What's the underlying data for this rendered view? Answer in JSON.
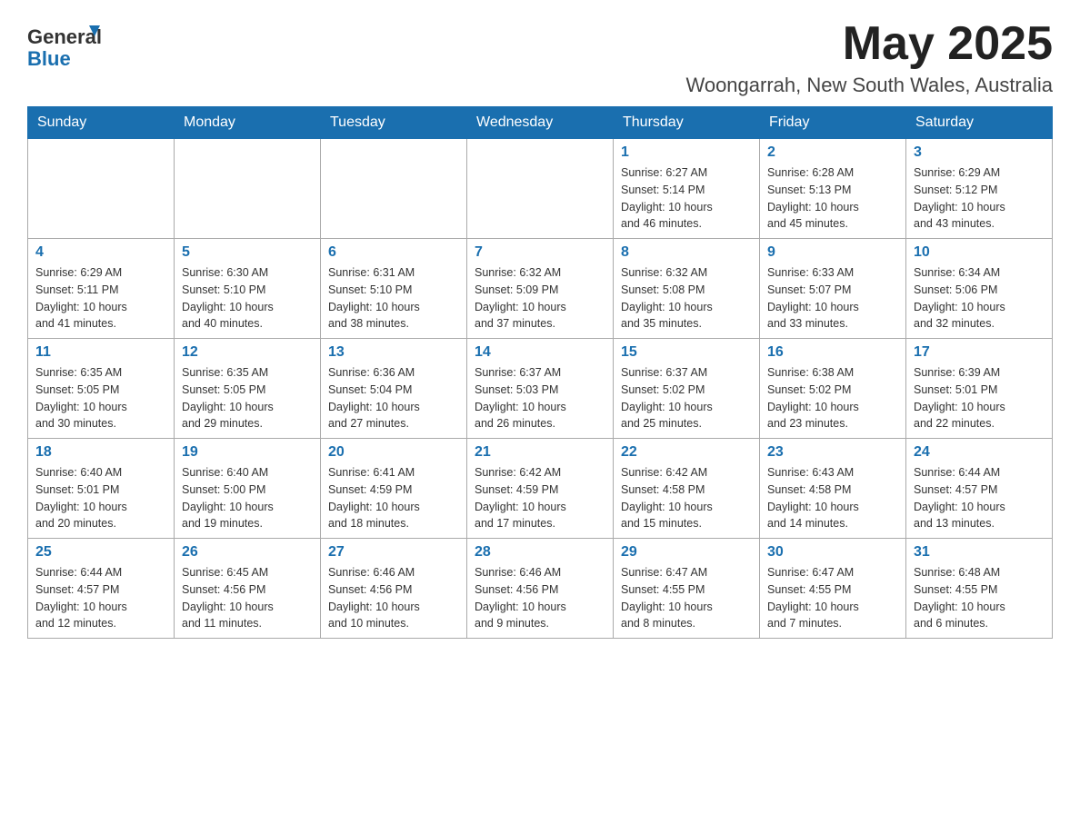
{
  "header": {
    "logo_general": "General",
    "logo_blue": "Blue",
    "month_title": "May 2025",
    "location": "Woongarrah, New South Wales, Australia"
  },
  "weekdays": [
    "Sunday",
    "Monday",
    "Tuesday",
    "Wednesday",
    "Thursday",
    "Friday",
    "Saturday"
  ],
  "weeks": [
    [
      {
        "day": "",
        "info": ""
      },
      {
        "day": "",
        "info": ""
      },
      {
        "day": "",
        "info": ""
      },
      {
        "day": "",
        "info": ""
      },
      {
        "day": "1",
        "info": "Sunrise: 6:27 AM\nSunset: 5:14 PM\nDaylight: 10 hours\nand 46 minutes."
      },
      {
        "day": "2",
        "info": "Sunrise: 6:28 AM\nSunset: 5:13 PM\nDaylight: 10 hours\nand 45 minutes."
      },
      {
        "day": "3",
        "info": "Sunrise: 6:29 AM\nSunset: 5:12 PM\nDaylight: 10 hours\nand 43 minutes."
      }
    ],
    [
      {
        "day": "4",
        "info": "Sunrise: 6:29 AM\nSunset: 5:11 PM\nDaylight: 10 hours\nand 41 minutes."
      },
      {
        "day": "5",
        "info": "Sunrise: 6:30 AM\nSunset: 5:10 PM\nDaylight: 10 hours\nand 40 minutes."
      },
      {
        "day": "6",
        "info": "Sunrise: 6:31 AM\nSunset: 5:10 PM\nDaylight: 10 hours\nand 38 minutes."
      },
      {
        "day": "7",
        "info": "Sunrise: 6:32 AM\nSunset: 5:09 PM\nDaylight: 10 hours\nand 37 minutes."
      },
      {
        "day": "8",
        "info": "Sunrise: 6:32 AM\nSunset: 5:08 PM\nDaylight: 10 hours\nand 35 minutes."
      },
      {
        "day": "9",
        "info": "Sunrise: 6:33 AM\nSunset: 5:07 PM\nDaylight: 10 hours\nand 33 minutes."
      },
      {
        "day": "10",
        "info": "Sunrise: 6:34 AM\nSunset: 5:06 PM\nDaylight: 10 hours\nand 32 minutes."
      }
    ],
    [
      {
        "day": "11",
        "info": "Sunrise: 6:35 AM\nSunset: 5:05 PM\nDaylight: 10 hours\nand 30 minutes."
      },
      {
        "day": "12",
        "info": "Sunrise: 6:35 AM\nSunset: 5:05 PM\nDaylight: 10 hours\nand 29 minutes."
      },
      {
        "day": "13",
        "info": "Sunrise: 6:36 AM\nSunset: 5:04 PM\nDaylight: 10 hours\nand 27 minutes."
      },
      {
        "day": "14",
        "info": "Sunrise: 6:37 AM\nSunset: 5:03 PM\nDaylight: 10 hours\nand 26 minutes."
      },
      {
        "day": "15",
        "info": "Sunrise: 6:37 AM\nSunset: 5:02 PM\nDaylight: 10 hours\nand 25 minutes."
      },
      {
        "day": "16",
        "info": "Sunrise: 6:38 AM\nSunset: 5:02 PM\nDaylight: 10 hours\nand 23 minutes."
      },
      {
        "day": "17",
        "info": "Sunrise: 6:39 AM\nSunset: 5:01 PM\nDaylight: 10 hours\nand 22 minutes."
      }
    ],
    [
      {
        "day": "18",
        "info": "Sunrise: 6:40 AM\nSunset: 5:01 PM\nDaylight: 10 hours\nand 20 minutes."
      },
      {
        "day": "19",
        "info": "Sunrise: 6:40 AM\nSunset: 5:00 PM\nDaylight: 10 hours\nand 19 minutes."
      },
      {
        "day": "20",
        "info": "Sunrise: 6:41 AM\nSunset: 4:59 PM\nDaylight: 10 hours\nand 18 minutes."
      },
      {
        "day": "21",
        "info": "Sunrise: 6:42 AM\nSunset: 4:59 PM\nDaylight: 10 hours\nand 17 minutes."
      },
      {
        "day": "22",
        "info": "Sunrise: 6:42 AM\nSunset: 4:58 PM\nDaylight: 10 hours\nand 15 minutes."
      },
      {
        "day": "23",
        "info": "Sunrise: 6:43 AM\nSunset: 4:58 PM\nDaylight: 10 hours\nand 14 minutes."
      },
      {
        "day": "24",
        "info": "Sunrise: 6:44 AM\nSunset: 4:57 PM\nDaylight: 10 hours\nand 13 minutes."
      }
    ],
    [
      {
        "day": "25",
        "info": "Sunrise: 6:44 AM\nSunset: 4:57 PM\nDaylight: 10 hours\nand 12 minutes."
      },
      {
        "day": "26",
        "info": "Sunrise: 6:45 AM\nSunset: 4:56 PM\nDaylight: 10 hours\nand 11 minutes."
      },
      {
        "day": "27",
        "info": "Sunrise: 6:46 AM\nSunset: 4:56 PM\nDaylight: 10 hours\nand 10 minutes."
      },
      {
        "day": "28",
        "info": "Sunrise: 6:46 AM\nSunset: 4:56 PM\nDaylight: 10 hours\nand 9 minutes."
      },
      {
        "day": "29",
        "info": "Sunrise: 6:47 AM\nSunset: 4:55 PM\nDaylight: 10 hours\nand 8 minutes."
      },
      {
        "day": "30",
        "info": "Sunrise: 6:47 AM\nSunset: 4:55 PM\nDaylight: 10 hours\nand 7 minutes."
      },
      {
        "day": "31",
        "info": "Sunrise: 6:48 AM\nSunset: 4:55 PM\nDaylight: 10 hours\nand 6 minutes."
      }
    ]
  ]
}
